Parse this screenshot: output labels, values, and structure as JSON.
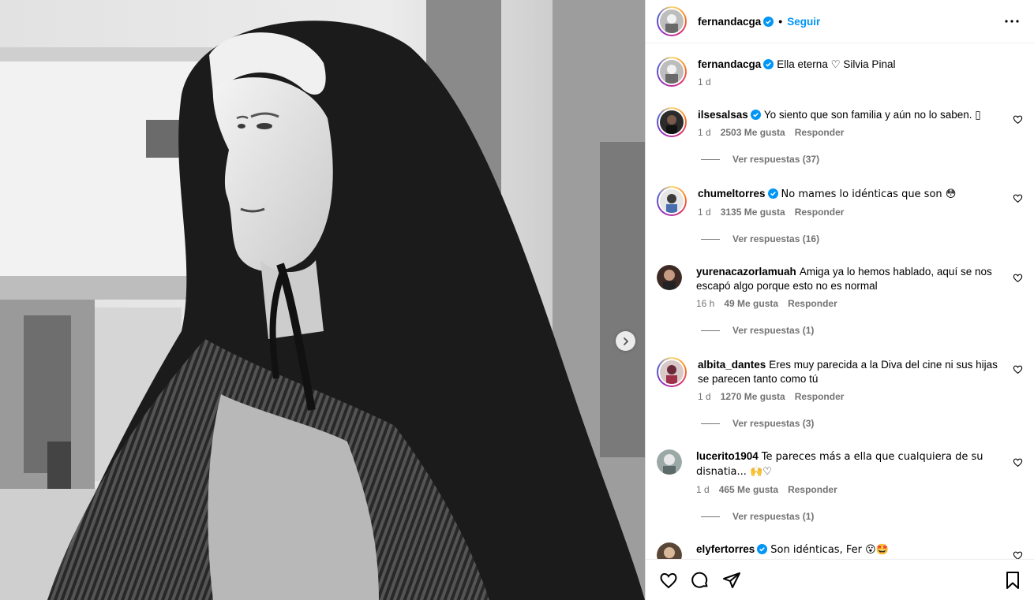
{
  "post": {
    "username": "fernandacga",
    "follow_label": "Seguir",
    "dot": "•",
    "caption": "Ella eterna ♡ Silvia Pinal",
    "age": "1 d"
  },
  "comments": [
    {
      "username": "ilsesalsas",
      "verified": true,
      "text": "Yo siento que son familia y aún no lo saben. ▯",
      "age": "1 d",
      "likes": "2503 Me gusta",
      "reply_label": "Responder",
      "replies_label": "Ver respuestas (37)"
    },
    {
      "username": "chumeltorres",
      "verified": true,
      "text": "No mames lo idénticas que son 😳",
      "age": "1 d",
      "likes": "3135 Me gusta",
      "reply_label": "Responder",
      "replies_label": "Ver respuestas (16)"
    },
    {
      "username": "yurenacazorlamuah",
      "verified": false,
      "text": "Amiga ya lo hemos hablado, aquí se nos escapó algo porque esto no es normal",
      "age": "16 h",
      "likes": "49 Me gusta",
      "reply_label": "Responder",
      "replies_label": "Ver respuestas (1)"
    },
    {
      "username": "albita_dantes",
      "verified": false,
      "text": "Eres muy parecida a la Diva del cine ni sus hijas se parecen tanto como tú",
      "age": "1 d",
      "likes": "1270 Me gusta",
      "reply_label": "Responder",
      "replies_label": "Ver respuestas (3)"
    },
    {
      "username": "lucerito1904",
      "verified": false,
      "text": "Te pareces más a ella que cualquiera de su disnatia... 🙌♡",
      "age": "1 d",
      "likes": "465 Me gusta",
      "reply_label": "Responder",
      "replies_label": "Ver respuestas (1)"
    },
    {
      "username": "elyfertorres",
      "verified": true,
      "text": "Son idénticas, Fer 😮🤩"
    }
  ],
  "icons": {
    "like": "heart-icon",
    "comment": "comment-icon",
    "share": "share-icon",
    "save": "bookmark-icon",
    "more": "more-options-icon",
    "next": "chevron-right-icon",
    "verified": "verified-badge-icon"
  },
  "colors": {
    "follow": "#0095f6",
    "verified": "#0095f6",
    "meta": "#737373"
  }
}
